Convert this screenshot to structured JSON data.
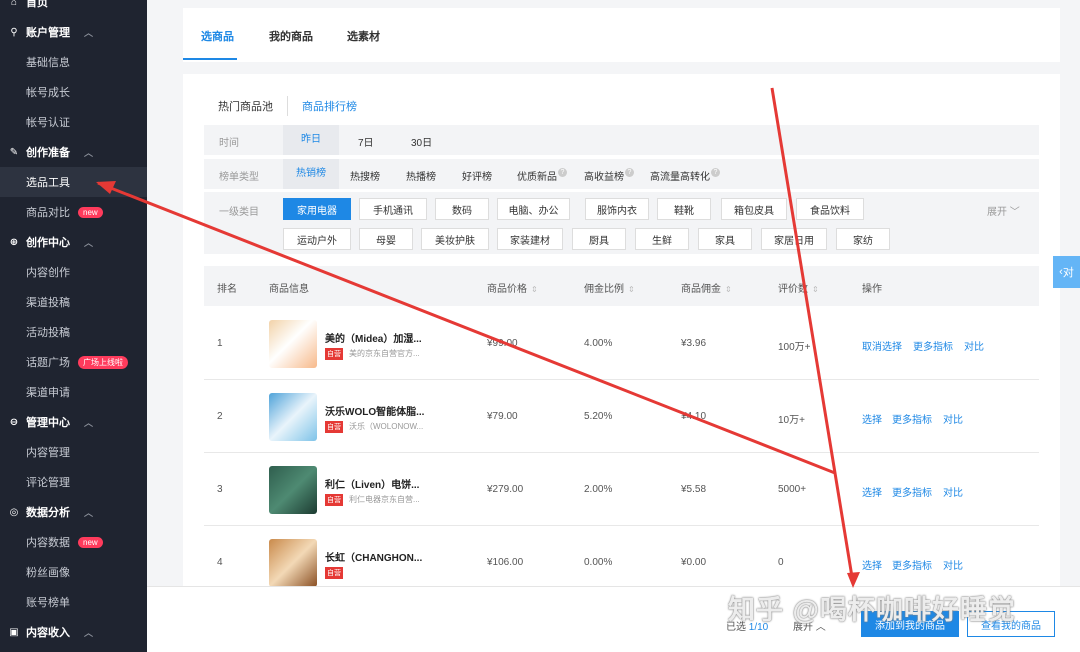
{
  "sidebar": {
    "home": "首页",
    "groups": [
      {
        "label": "账户管理",
        "items": [
          "基础信息",
          "帐号成长",
          "帐号认证"
        ]
      },
      {
        "label": "创作准备",
        "items": [
          "选品工具",
          "商品对比"
        ]
      },
      {
        "label": "创作中心",
        "items": [
          "内容创作",
          "渠道投稿",
          "活动投稿",
          "话题广场",
          "渠道申请"
        ]
      },
      {
        "label": "管理中心",
        "items": [
          "内容管理",
          "评论管理"
        ]
      },
      {
        "label": "数据分析",
        "items": [
          "内容数据",
          "粉丝画像",
          "账号榜单"
        ]
      },
      {
        "label": "内容收入"
      }
    ],
    "badge_new": "new",
    "badge_hot": "广场上线啦"
  },
  "tabs": [
    "选商品",
    "我的商品",
    "选素材"
  ],
  "subtabs": [
    "热门商品池",
    "商品排行榜"
  ],
  "filters": {
    "time_label": "时间",
    "time_options": [
      "昨日",
      "7日",
      "30日"
    ],
    "type_label": "榜单类型",
    "type_options": [
      "热销榜",
      "热搜榜",
      "热播榜",
      "好评榜",
      "优质新品",
      "高收益榜",
      "高流量高转化"
    ],
    "category_label": "一级类目",
    "categories_row1": [
      "家用电器",
      "手机通讯",
      "数码",
      "电脑、办公",
      "服饰内衣",
      "鞋靴",
      "箱包皮具",
      "食品饮料"
    ],
    "categories_row2": [
      "运动户外",
      "母婴",
      "美妆护肤",
      "家装建材",
      "厨具",
      "生鲜",
      "家具",
      "家居日用",
      "家纺"
    ],
    "expand": "展开"
  },
  "table": {
    "headers": {
      "rank": "排名",
      "info": "商品信息",
      "price": "商品价格",
      "ratio": "佣金比例",
      "commission": "商品佣金",
      "reviews": "评价数",
      "ops": "操作"
    },
    "rows": [
      {
        "rank": "1",
        "name": "美的（Midea）加湿...",
        "shop": "美的京东自营官方...",
        "price": "¥99.00",
        "ratio": "4.00%",
        "commission": "¥3.96",
        "reviews": "100万+",
        "op1": "取消选择",
        "op2": "更多指标",
        "op3": "对比"
      },
      {
        "rank": "2",
        "name": "沃乐WOLO智能体脂...",
        "shop": "沃乐（WOLONOW...",
        "price": "¥79.00",
        "ratio": "5.20%",
        "commission": "¥4.10",
        "reviews": "10万+",
        "op1": "选择",
        "op2": "更多指标",
        "op3": "对比"
      },
      {
        "rank": "3",
        "name": "利仁（Liven）电饼...",
        "shop": "利仁电器京东自营...",
        "price": "¥279.00",
        "ratio": "2.00%",
        "commission": "¥5.58",
        "reviews": "5000+",
        "op1": "选择",
        "op2": "更多指标",
        "op3": "对比"
      },
      {
        "rank": "4",
        "name": "长虹（CHANGHON...",
        "shop": "",
        "price": "¥106.00",
        "ratio": "0.00%",
        "commission": "¥0.00",
        "reviews": "0",
        "op1": "选择",
        "op2": "更多指标",
        "op3": "对比"
      }
    ],
    "self_tag": "自营"
  },
  "bottom": {
    "selected_prefix": "已选 ",
    "selected": "1/10",
    "expand": "展开",
    "add_button": "添加到我的商品",
    "view_button": "查看我的商品"
  },
  "side_tab": "对",
  "watermark": "知乎 @喝杯咖啡好睡觉",
  "colors": {
    "accent": "#1e88e5",
    "sidebar": "#1f2430",
    "badge": "#ff3b5c",
    "arrow": "#e53935"
  }
}
